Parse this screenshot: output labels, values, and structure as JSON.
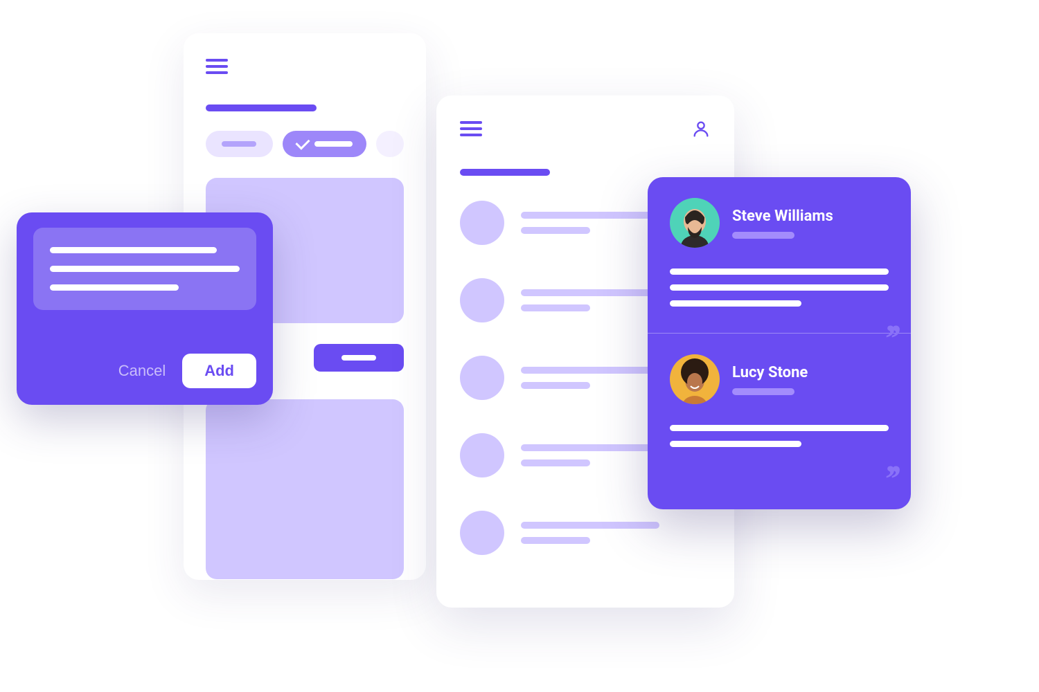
{
  "modal": {
    "cancel_label": "Cancel",
    "add_label": "Add"
  },
  "testimonials": [
    {
      "name": "Steve Williams"
    },
    {
      "name": "Lucy Stone"
    }
  ]
}
